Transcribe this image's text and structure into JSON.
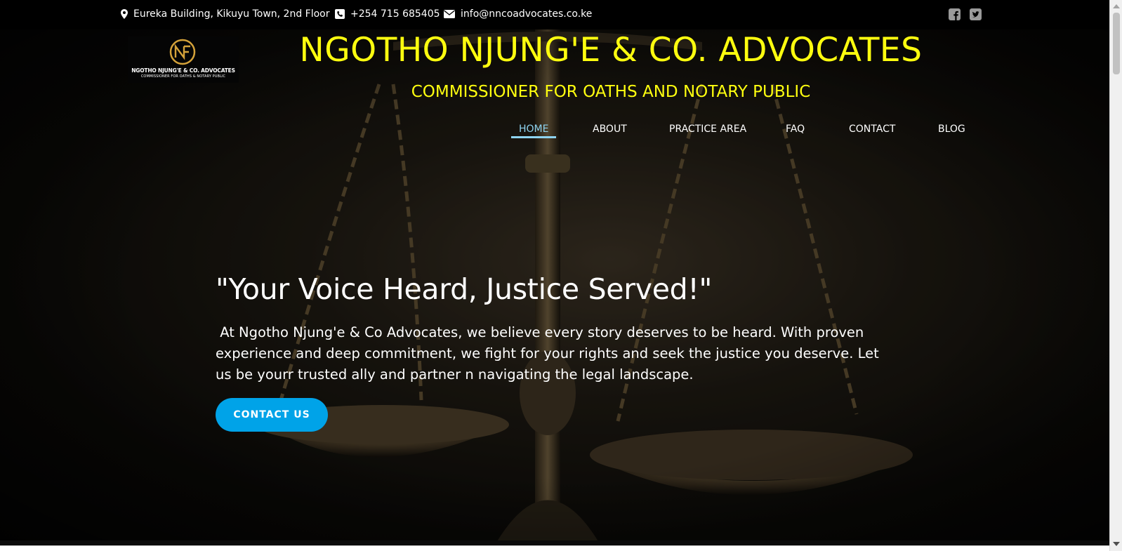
{
  "topbar": {
    "address": "Eureka Building, Kikuyu Town, 2nd Floor",
    "phone": "+254 715 685405",
    "email": "info@nncoadvocates.co.ke",
    "social_icons": [
      "facebook-icon",
      "twitter-icon"
    ]
  },
  "logo": {
    "monogram": "NF",
    "name": "NGOTHO NJUNG'E & CO. ADVOCATES",
    "tagline": "COMMISSIONER FOR OATHS & NOTARY PUBLIC"
  },
  "header": {
    "title": "NGOTHO NJUNG'E & CO. ADVOCATES",
    "subtitle": "COMMISSIONER FOR OATHS AND NOTARY PUBLIC"
  },
  "nav": {
    "items": [
      {
        "label": "HOME",
        "active": true
      },
      {
        "label": "ABOUT",
        "active": false
      },
      {
        "label": "PRACTICE AREA",
        "active": false
      },
      {
        "label": "FAQ",
        "active": false
      },
      {
        "label": "CONTACT",
        "active": false
      },
      {
        "label": "BLOG",
        "active": false
      }
    ]
  },
  "hero": {
    "heading": "\"Your Voice Heard, Justice Served!\"",
    "paragraph": " At Ngotho Njung'e & Co Advocates, we believe every story deserves to be heard. With proven experience and deep commitment, we fight for your rights and seek the justice you deserve. Let us be yourr trusted ally and partner n navigating the legal landscape.",
    "button_label": "CONTACT US",
    "background_image": "scales-of-justice"
  },
  "colors": {
    "title_yellow": "#ffff0f",
    "accent_blue": "#00a3e8",
    "nav_active": "#8ed3f0",
    "logo_gold": "#d4a23a"
  }
}
